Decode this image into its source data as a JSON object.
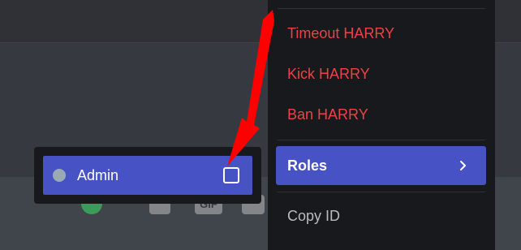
{
  "context_menu": {
    "items": [
      {
        "label": "Timeout HARRY",
        "style": "danger"
      },
      {
        "label": "Kick HARRY",
        "style": "danger"
      },
      {
        "label": "Ban HARRY",
        "style": "danger"
      },
      {
        "label": "Roles",
        "style": "active",
        "icon": "chevron-right-icon"
      },
      {
        "label": "Copy ID",
        "style": "normal"
      }
    ]
  },
  "role_popout": {
    "role": {
      "label": "Admin",
      "color": "#99aab5",
      "checked": false
    }
  },
  "composer": {
    "gif_label": "GIF"
  },
  "colors": {
    "danger": "#ed4245",
    "accent": "#4752c4",
    "annotation_arrow": "#ff0000"
  }
}
